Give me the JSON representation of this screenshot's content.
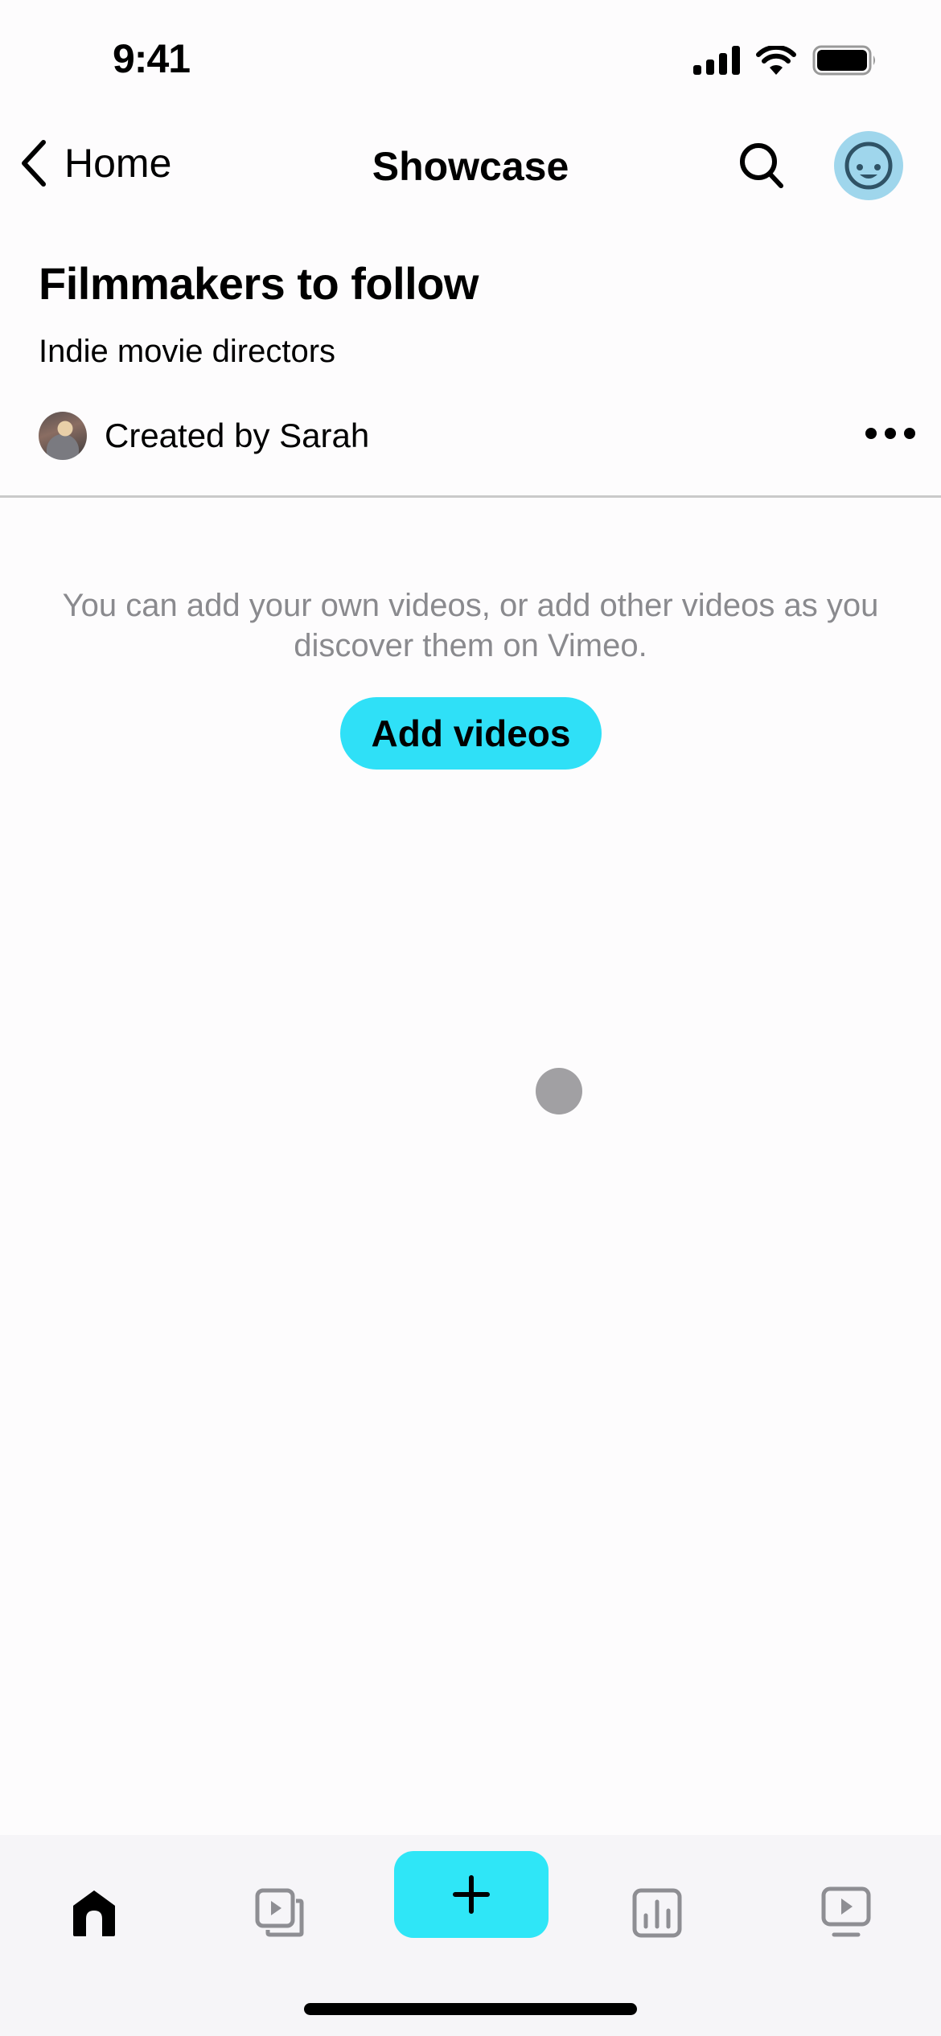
{
  "status_bar": {
    "time": "9:41",
    "icons": [
      "cellular-signal-icon",
      "wifi-icon",
      "battery-icon"
    ]
  },
  "nav": {
    "back_label": "Home",
    "title": "Showcase",
    "actions": [
      "search-icon",
      "profile-avatar-icon"
    ]
  },
  "showcase": {
    "title": "Filmmakers to follow",
    "description": "Indie movie directors",
    "creator_label": "Created by Sarah",
    "more_icon": "ellipsis-icon"
  },
  "empty_state": {
    "message": "You can add your own videos, or add other videos as you discover them on Vimeo.",
    "button_label": "Add videos"
  },
  "tab_bar": {
    "tabs": [
      {
        "name": "home",
        "icon": "home-icon",
        "active": true
      },
      {
        "name": "library",
        "icon": "video-stack-icon",
        "active": false
      },
      {
        "name": "create",
        "icon": "plus-icon",
        "active": false
      },
      {
        "name": "analytics",
        "icon": "bar-chart-icon",
        "active": false
      },
      {
        "name": "watch",
        "icon": "tv-play-icon",
        "active": false
      }
    ]
  },
  "colors": {
    "accent": "#2fe0f7",
    "avatar_bg": "#9fd6ec",
    "avatar_fg": "#2f5366",
    "muted_text": "#8a8a8e",
    "inactive_icon": "#8e8e93",
    "divider": "#cacaca",
    "tab_bar_bg": "#f6f5f8"
  }
}
